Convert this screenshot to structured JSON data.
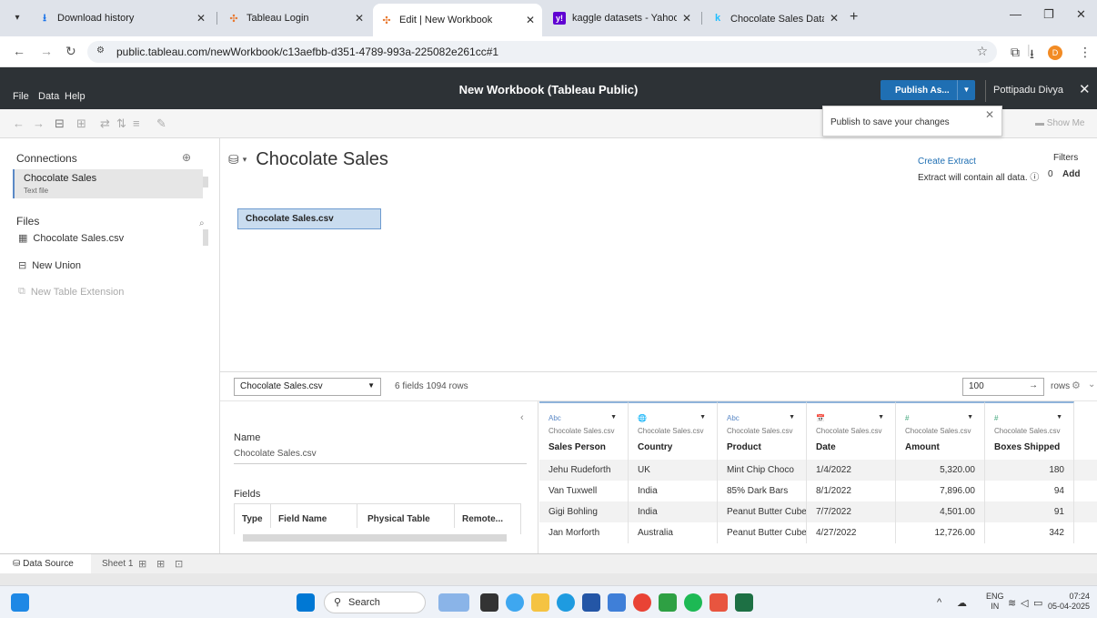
{
  "browser": {
    "tabs": [
      {
        "label": "Download history",
        "icon": "download-icon"
      },
      {
        "label": "Tableau Login",
        "icon": "tableau-icon"
      },
      {
        "label": "Edit | New Workbook",
        "icon": "tableau-icon",
        "active": true
      },
      {
        "label": "kaggle datasets - Yahoo India S",
        "icon": "yahoo-icon"
      },
      {
        "label": "Chocolate Sales Data 📊🍫",
        "icon": "kaggle-icon"
      }
    ],
    "url": "public.tableau.com/newWorkbook/c13aefbb-d351-4789-993a-225082e261cc#1",
    "profile_initial": "D"
  },
  "app": {
    "menu": [
      "File",
      "Data",
      "Help"
    ],
    "title": "New Workbook (Tableau Public)",
    "publish_label": "Publish As...",
    "user": "Pottipadu Divya",
    "tooltip": "Publish to save your changes",
    "show_me": "Show Me"
  },
  "left_pane": {
    "connections_title": "Connections",
    "connection": {
      "name": "Chocolate Sales",
      "type": "Text file"
    },
    "files_title": "Files",
    "file": "Chocolate Sales.csv",
    "new_union": "New Union",
    "new_table_extension": "New Table Extension"
  },
  "canvas": {
    "title": "Chocolate Sales",
    "create_extract": "Create Extract",
    "extract_note": "Extract will contain all data.",
    "filters_label": "Filters",
    "filters_count": "0",
    "filters_add": "Add",
    "table_chip": "Chocolate Sales.csv"
  },
  "grid_header": {
    "table_select": "Chocolate Sales.csv",
    "field_count": "6 fields 1094 rows",
    "rows_value": "100",
    "rows_label": "rows"
  },
  "metadata": {
    "name_label": "Name",
    "name_value": "Chocolate Sales.csv",
    "fields_label": "Fields",
    "columns": [
      "Type",
      "Field Name",
      "Physical Table",
      "Remote..."
    ]
  },
  "grid": {
    "columns": [
      {
        "type": "Abc",
        "source": "Chocolate Sales.csv",
        "name": "Sales Person"
      },
      {
        "type": "🌐",
        "source": "Chocolate Sales.csv",
        "name": "Country"
      },
      {
        "type": "Abc",
        "source": "Chocolate Sales.csv",
        "name": "Product"
      },
      {
        "type": "📅",
        "source": "Chocolate Sales.csv",
        "name": "Date"
      },
      {
        "type": "#",
        "source": "Chocolate Sales.csv",
        "name": "Amount"
      },
      {
        "type": "#",
        "source": "Chocolate Sales.csv",
        "name": "Boxes Shipped"
      }
    ],
    "rows": [
      [
        "Jehu Rudeforth",
        "UK",
        "Mint Chip Choco",
        "1/4/2022",
        "5,320.00",
        "180"
      ],
      [
        "Van Tuxwell",
        "India",
        "85% Dark Bars",
        "8/1/2022",
        "7,896.00",
        "94"
      ],
      [
        "Gigi Bohling",
        "India",
        "Peanut Butter Cubes",
        "7/7/2022",
        "4,501.00",
        "91"
      ],
      [
        "Jan Morforth",
        "Australia",
        "Peanut Butter Cubes",
        "4/27/2022",
        "12,726.00",
        "342"
      ]
    ]
  },
  "sheetbar": {
    "data_source": "Data Source",
    "sheet1": "Sheet 1"
  },
  "taskbar": {
    "search": "Search",
    "lang_top": "ENG",
    "lang_bottom": "IN",
    "time": "07:24",
    "date": "05-04-2025"
  }
}
